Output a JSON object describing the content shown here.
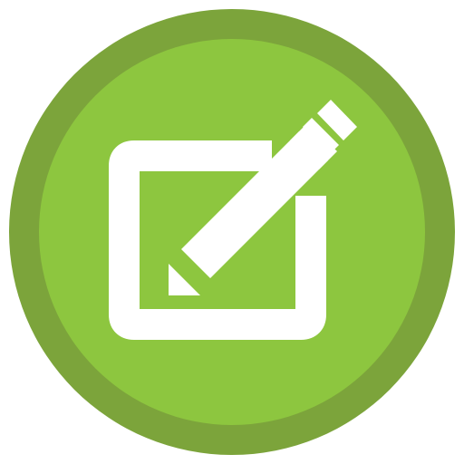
{
  "icon": {
    "semantic": "edit-icon",
    "colors": {
      "outer_ring": "#7CA43B",
      "inner_fill": "#8DC63F",
      "glyph": "#FFFFFF"
    }
  }
}
